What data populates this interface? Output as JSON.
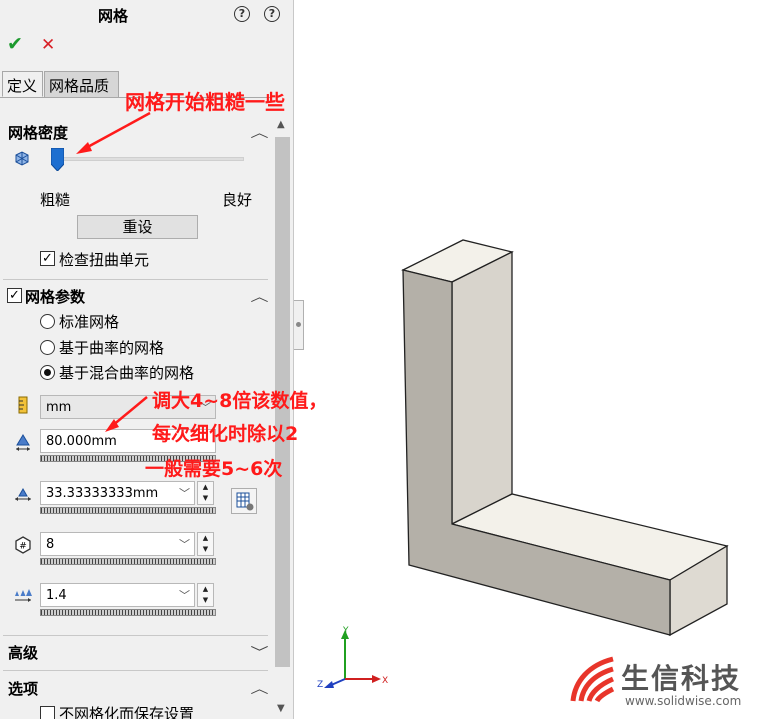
{
  "panel": {
    "title": "网格",
    "help1_icon": "help-tips-icon",
    "help2_label": "?",
    "ok_icon": "✔",
    "cancel_icon": "✕",
    "tabs": [
      {
        "label": "定义",
        "active": true
      },
      {
        "label": "网格品质",
        "active": false
      }
    ],
    "density": {
      "title": "网格密度",
      "coarse_label": "粗糙",
      "fine_label": "良好",
      "slider_fraction": 0.0,
      "reset_label": "重设",
      "check_distortion_label": "检查扭曲单元",
      "check_distortion_checked": true
    },
    "params": {
      "title": "网格参数",
      "checked": true,
      "options": [
        {
          "label": "标准网格",
          "selected": false
        },
        {
          "label": "基于曲率的网格",
          "selected": false
        },
        {
          "label": "基于混合曲率的网格",
          "selected": true
        }
      ],
      "unit": "mm",
      "max_element_size": "80.000mm",
      "min_element_size": "33.33333333mm",
      "circle_elements": "8",
      "growth_ratio": "1.4"
    },
    "advanced_title": "高级",
    "options_title": "选项",
    "save_without_mesh_label": "不网格化而保存设置"
  },
  "annotations": {
    "note1": "网格开始粗糙一些",
    "note2_line1": "调大4~8倍该数值，",
    "note2_line2": "每次细化时除以2",
    "note2_line3": "一般需要5~6次"
  },
  "triad": {
    "y": "Y",
    "x": "X",
    "z": "Z"
  },
  "watermark": {
    "name": "生信科技",
    "url": "www.solidwise.com"
  },
  "colors": {
    "accent_red": "#ff1a1a",
    "ok_green": "#1c9a2e",
    "cancel_red": "#d81f26",
    "slider_blue": "#1e6fd0"
  }
}
